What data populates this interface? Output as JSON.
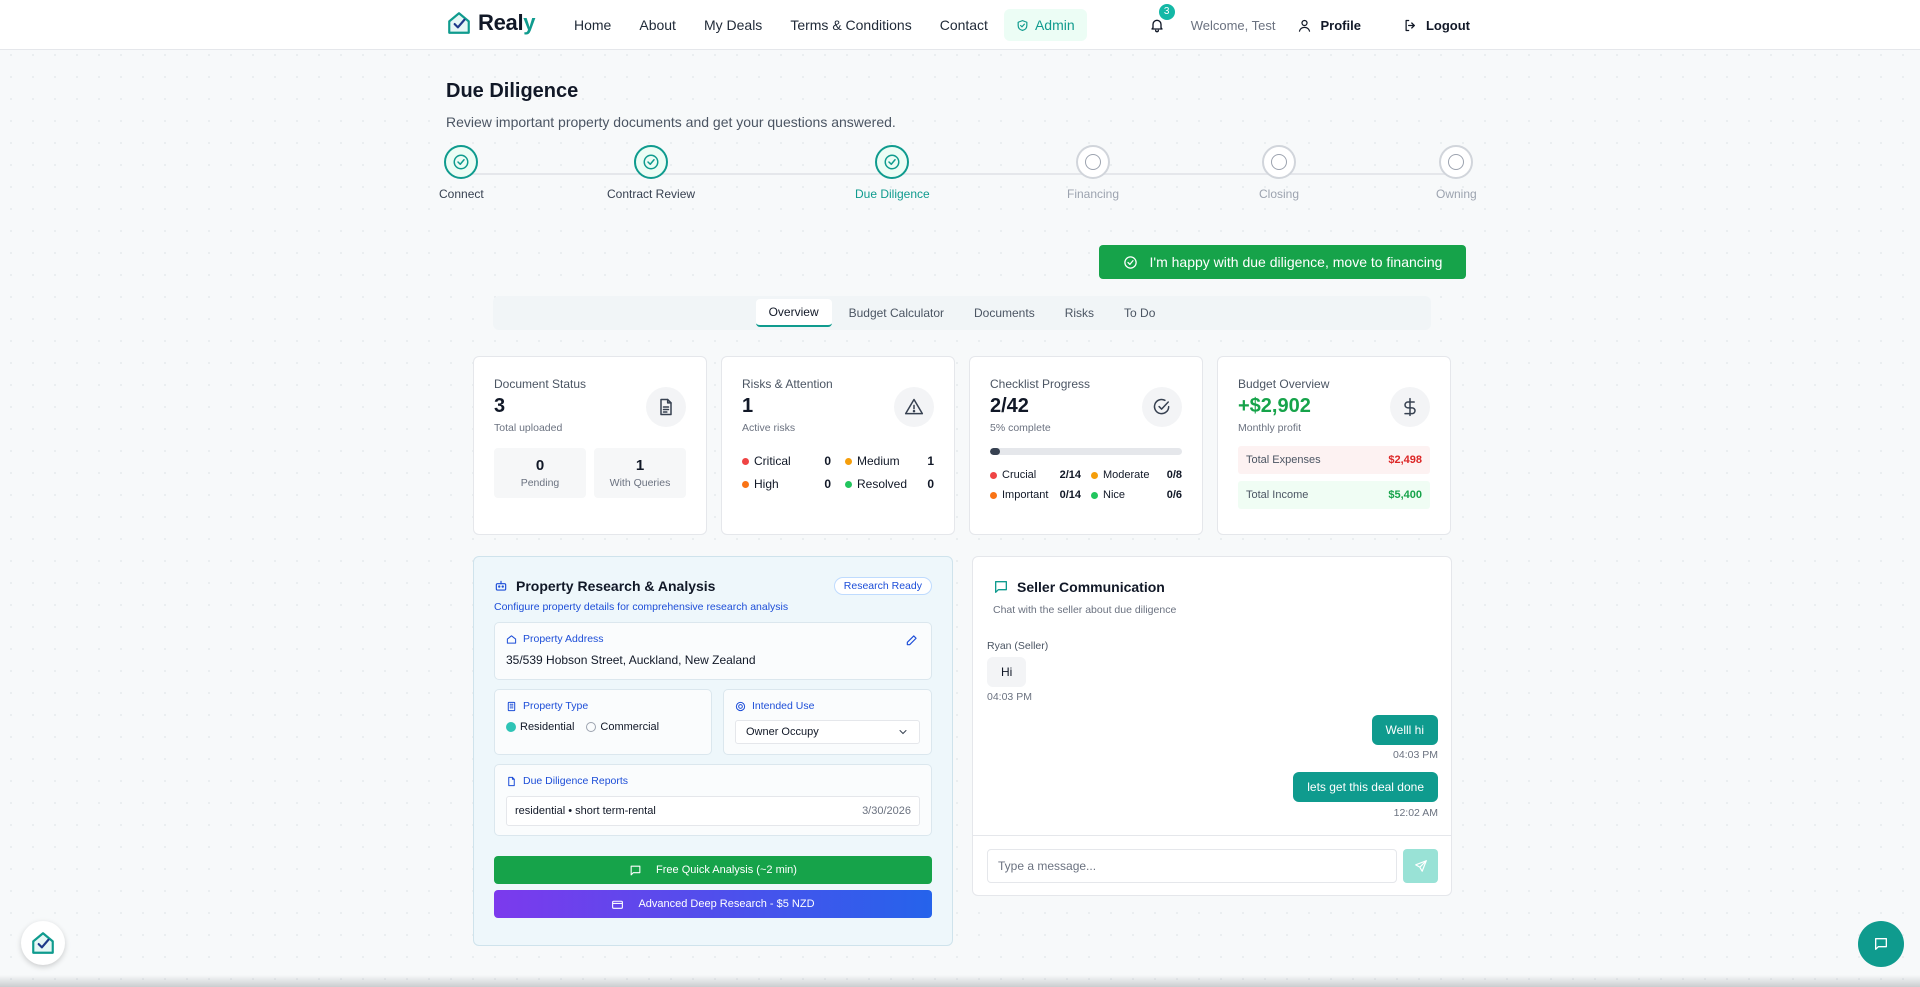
{
  "header": {
    "brand": {
      "main": "Real",
      "accent": "y"
    },
    "nav": [
      "Home",
      "About",
      "My Deals",
      "Terms & Conditions",
      "Contact"
    ],
    "admin_label": "Admin",
    "notification_count": "3",
    "welcome": "Welcome, Test",
    "profile": "Profile",
    "logout": "Logout"
  },
  "page": {
    "title": "Due Diligence",
    "subtitle": "Review important property documents and get your questions answered."
  },
  "stepper": [
    {
      "label": "Connect",
      "state": "done"
    },
    {
      "label": "Contract Review",
      "state": "done"
    },
    {
      "label": "Due Diligence",
      "state": "active"
    },
    {
      "label": "Financing",
      "state": "pending"
    },
    {
      "label": "Closing",
      "state": "pending"
    },
    {
      "label": "Owning",
      "state": "pending"
    }
  ],
  "cta": "I'm happy with due diligence, move to financing",
  "tabs": [
    "Overview",
    "Budget Calculator",
    "Documents",
    "Risks",
    "To Do"
  ],
  "cards": {
    "documents": {
      "label": "Document Status",
      "value": "3",
      "sub": "Total uploaded",
      "pending": {
        "value": "0",
        "label": "Pending"
      },
      "queries": {
        "value": "1",
        "label": "With Queries"
      }
    },
    "risks": {
      "label": "Risks & Attention",
      "value": "1",
      "sub": "Active risks",
      "items": [
        {
          "label": "Critical",
          "value": "0",
          "color": "#ef4444"
        },
        {
          "label": "Medium",
          "value": "1",
          "color": "#f59e0b"
        },
        {
          "label": "High",
          "value": "0",
          "color": "#f97316"
        },
        {
          "label": "Resolved",
          "value": "0",
          "color": "#22c55e"
        }
      ]
    },
    "checklist": {
      "label": "Checklist Progress",
      "value": "2/42",
      "sub": "5% complete",
      "progress": 0.05,
      "items": [
        {
          "label": "Crucial",
          "value": "2/14",
          "color": "#ef4444"
        },
        {
          "label": "Moderate",
          "value": "0/8",
          "color": "#f59e0b"
        },
        {
          "label": "Important",
          "value": "0/14",
          "color": "#f97316"
        },
        {
          "label": "Nice",
          "value": "0/6",
          "color": "#22c55e"
        }
      ]
    },
    "budget": {
      "label": "Budget Overview",
      "value": "+$2,902",
      "sub": "Monthly profit",
      "expenses": {
        "label": "Total Expenses",
        "value": "$2,498"
      },
      "income": {
        "label": "Total Income",
        "value": "$5,400"
      }
    }
  },
  "research": {
    "title": "Property Research & Analysis",
    "badge": "Research Ready",
    "subtitle": "Configure property details for comprehensive research analysis",
    "address_label": "Property Address",
    "address": "35/539 Hobson Street, Auckland, New Zealand",
    "type_label": "Property Type",
    "types": [
      "Residential",
      "Commercial"
    ],
    "selected_type": "Residential",
    "use_label": "Intended Use",
    "use_value": "Owner Occupy",
    "reports_label": "Due Diligence Reports",
    "report": {
      "name": "residential • short term-rental",
      "date": "3/30/2026"
    },
    "btn_quick": "Free Quick Analysis (~2 min)",
    "btn_deep": "Advanced Deep Research - $5 NZD"
  },
  "seller": {
    "title": "Seller Communication",
    "subtitle": "Chat with the seller about due diligence",
    "messages": [
      {
        "sender": "Ryan (Seller)",
        "text": "Hi",
        "time": "04:03 PM",
        "dir": "in"
      },
      {
        "text": "Welll hi",
        "time": "04:03 PM",
        "dir": "out"
      },
      {
        "text": "lets get this deal done",
        "time": "12:02 AM",
        "dir": "out"
      }
    ],
    "placeholder": "Type a message..."
  },
  "colors": {
    "brand": "#0f9b8e",
    "cta": "#16a34a",
    "expense": "#dc2626",
    "income": "#16a34a",
    "quick_btn": "#16a34a",
    "deep_btn_from": "#7c3aed",
    "deep_btn_to": "#2563eb"
  },
  "icons": {
    "logo": "house-check-icon",
    "bell": "bell-icon",
    "user": "user-icon",
    "logout": "logout-icon",
    "documents": "document-icon",
    "risks": "warning-triangle-icon",
    "checklist": "check-circle-icon",
    "budget": "dollar-icon",
    "chat": "chat-bubble-icon",
    "send": "send-icon"
  }
}
